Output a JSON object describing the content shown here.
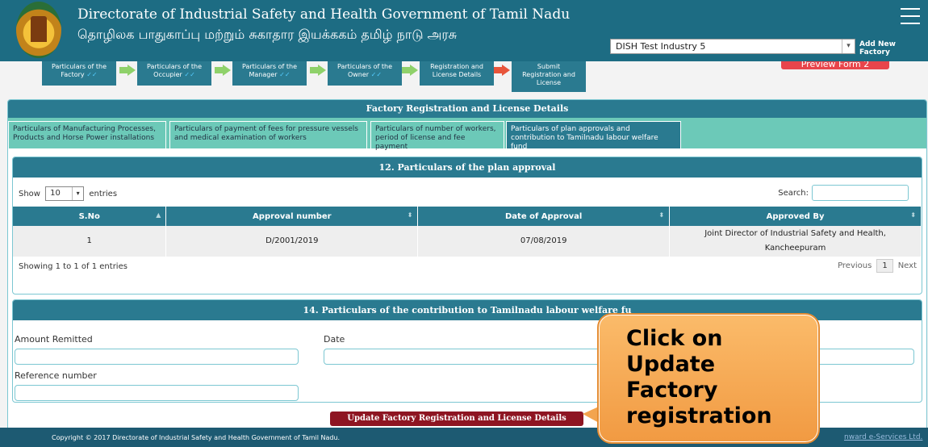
{
  "header": {
    "title_en": "Directorate of Industrial Safety and Health Government of Tamil Nadu",
    "title_ta": "தொழிலக பாதுகாப்பு மற்றும் சுகாதார இயக்ககம் தமிழ் நாடு அரசு",
    "factory_select": "DISH Test Industry 5",
    "add_factory": "Add New Factory"
  },
  "steps": [
    {
      "line1": "Particulars of the",
      "line2": "Factory",
      "tick": "✓✓"
    },
    {
      "line1": "Particulars of the",
      "line2": "Occupier",
      "tick": "✓✓"
    },
    {
      "line1": "Particulars of the",
      "line2": "Manager",
      "tick": "✓✓"
    },
    {
      "line1": "Particulars of the",
      "line2": "Owner",
      "tick": "✓✓"
    },
    {
      "line1": "Registration and",
      "line2": "License Details",
      "tick": ""
    },
    {
      "line1": "Submit",
      "line2": "Registration and",
      "line3": "License",
      "tick": ""
    }
  ],
  "preview_button": "Preview Form 2",
  "panel_title": "Factory Registration and License Details",
  "tabs": [
    {
      "line1": "Particulars of Manufacturing Processes,",
      "line2": "Products and Horse Power installations"
    },
    {
      "line1": "Particulars of payment of fees for pressure vessels",
      "line2": "and medical examination of workers"
    },
    {
      "line1": "Particulars of number of workers,",
      "line2": "period of license and fee payment"
    },
    {
      "line1": "Particulars of plan approvals and",
      "line2": "contribution to Tamilnadu labour welfare fund"
    }
  ],
  "plan_section": {
    "title": "12. Particulars of the plan approval",
    "show": "Show",
    "entries_value": "10",
    "entries": "entries",
    "search": "Search:",
    "columns": [
      "S.No",
      "Approval number",
      "Date of Approval",
      "Approved By"
    ],
    "row": {
      "sno": "1",
      "approval_number": "D/2001/2019",
      "date": "07/08/2019",
      "approved_by_1": "Joint Director of Industrial Safety and Health,",
      "approved_by_2": "Kancheepuram"
    },
    "info": "Showing 1 to 1 of 1 entries",
    "prev": "Previous",
    "page": "1",
    "next": "Next"
  },
  "welfare_section": {
    "title": "14. Particulars of the contribution to Tamilnadu labour welfare fu",
    "amount_label": "Amount Remitted",
    "date_label": "Date",
    "reference_label": "Reference number"
  },
  "update_button": "Update Factory Registration and License Details",
  "footer": {
    "copyright": "Copyright © 2017 Directorate of Industrial Safety and Health Government of Tamil Nadu.",
    "credit": "nward e-Services Ltd."
  },
  "callout": {
    "line1": "Click on",
    "line2": "Update",
    "line3": "Factory",
    "line4": "registration"
  }
}
